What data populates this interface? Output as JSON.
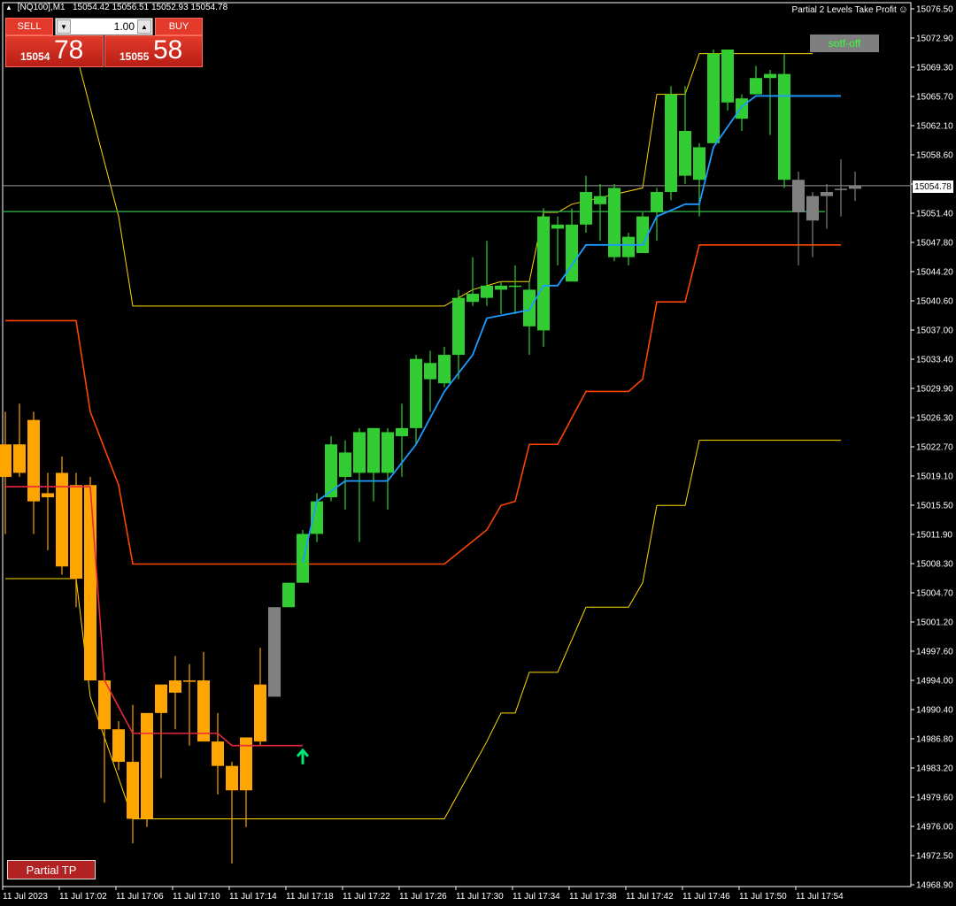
{
  "header": {
    "symbol": "[NQ100],M1",
    "ohlc": "15054.42 15056.51 15052.93 15054.78",
    "ea_name": "Partial 2 Levels Take Profit",
    "ea_icon": "smiley-icon"
  },
  "trade_panel": {
    "sell_label": "SELL",
    "buy_label": "BUY",
    "lot": "1.00",
    "bid_prefix": "15054",
    "bid_big": "78",
    "ask_prefix": "15055",
    "ask_big": "58"
  },
  "buttons": {
    "softoff_label": "sotf-off",
    "partial_tp_label": "Partial TP"
  },
  "current_price_label": "15054.78",
  "colors": {
    "bull_green": "#32cd32",
    "bear_orange": "#ffa500",
    "neutral_gray": "#808080",
    "grid_frame": "#ffffff",
    "blue_line": "#1e9bff",
    "red_line": "#ff4500",
    "yellow_line": "#ffd700",
    "green_hline": "#2ea043",
    "signal_arrow": "#00e676"
  },
  "chart_data": {
    "type": "candlestick",
    "y_ticks": [
      "15076.50",
      "15072.90",
      "15069.30",
      "15065.70",
      "15062.10",
      "15058.60",
      "15055.00",
      "15051.40",
      "15047.80",
      "15044.20",
      "15040.60",
      "15037.00",
      "15033.40",
      "15029.90",
      "15026.30",
      "15022.70",
      "15019.10",
      "15015.50",
      "15011.90",
      "15008.30",
      "15004.70",
      "15001.20",
      "14997.60",
      "14994.00",
      "14990.40",
      "14986.80",
      "14983.20",
      "14979.60",
      "14976.00",
      "14972.50",
      "14968.90"
    ],
    "x_ticks": [
      "11 Jul 2023",
      "11 Jul 17:02",
      "11 Jul 17:06",
      "11 Jul 17:10",
      "11 Jul 17:14",
      "11 Jul 17:18",
      "11 Jul 17:22",
      "11 Jul 17:26",
      "11 Jul 17:30",
      "11 Jul 17:34",
      "11 Jul 17:38",
      "11 Jul 17:42",
      "11 Jul 17:46",
      "11 Jul 17:50",
      "11 Jul 17:54"
    ],
    "ylim": [
      14968.9,
      15076.5
    ],
    "current_price": 15054.78,
    "green_level": 15051.6,
    "candles": [
      {
        "o": 15019.0,
        "h": 15027.0,
        "l": 15012.0,
        "c": 15023.0,
        "col": "orange"
      },
      {
        "o": 15023.0,
        "h": 15028.0,
        "l": 15019.0,
        "c": 15019.5,
        "col": "orange"
      },
      {
        "o": 15026.0,
        "h": 15027.0,
        "l": 15012.0,
        "c": 15016.0,
        "col": "orange"
      },
      {
        "o": 15016.5,
        "h": 15019.5,
        "l": 15010.0,
        "c": 15017.0,
        "col": "orange"
      },
      {
        "o": 15019.5,
        "h": 15021.5,
        "l": 15007.0,
        "c": 15008.0,
        "col": "orange"
      },
      {
        "o": 15018.0,
        "h": 15019.5,
        "l": 15003.0,
        "c": 15006.5,
        "col": "orange"
      },
      {
        "o": 15018.0,
        "h": 15019.0,
        "l": 14994.0,
        "c": 14994.0,
        "col": "orange"
      },
      {
        "o": 14994.0,
        "h": 14995.0,
        "l": 14979.0,
        "c": 14988.0,
        "col": "orange"
      },
      {
        "o": 14988.0,
        "h": 14989.0,
        "l": 14983.0,
        "c": 14984.0,
        "col": "orange"
      },
      {
        "o": 14984.0,
        "h": 14991.0,
        "l": 14974.0,
        "c": 14977.0,
        "col": "orange"
      },
      {
        "o": 14977.0,
        "h": 14990.0,
        "l": 14976.0,
        "c": 14990.0,
        "col": "orange"
      },
      {
        "o": 14990.0,
        "h": 14993.0,
        "l": 14982.0,
        "c": 14993.5,
        "col": "orange"
      },
      {
        "o": 14992.5,
        "h": 14997.0,
        "l": 14988.0,
        "c": 14994.0,
        "col": "orange"
      },
      {
        "o": 14994.0,
        "h": 14996.0,
        "l": 14986.0,
        "c": 14994.0,
        "col": "orange"
      },
      {
        "o": 14994.0,
        "h": 14997.5,
        "l": 14986.5,
        "c": 14986.5,
        "col": "orange"
      },
      {
        "o": 14986.5,
        "h": 14990.0,
        "l": 14980.0,
        "c": 14983.5,
        "col": "orange"
      },
      {
        "o": 14983.5,
        "h": 14984.0,
        "l": 14971.5,
        "c": 14980.5,
        "col": "orange"
      },
      {
        "o": 14980.5,
        "h": 14987.0,
        "l": 14976.0,
        "c": 14987.0,
        "col": "orange"
      },
      {
        "o": 14986.5,
        "h": 14998.0,
        "l": 14986.0,
        "c": 14993.5,
        "col": "orange"
      },
      {
        "o": 14992.0,
        "h": 15003.0,
        "l": 14992.0,
        "c": 15003.0,
        "col": "gray"
      },
      {
        "o": 15003.0,
        "h": 15006.0,
        "l": 15003.0,
        "c": 15006.0,
        "col": "green"
      },
      {
        "o": 15006.0,
        "h": 15012.5,
        "l": 15006.0,
        "c": 15012.0,
        "col": "green"
      },
      {
        "o": 15012.0,
        "h": 15017.0,
        "l": 15011.0,
        "c": 15016.0,
        "col": "green"
      },
      {
        "o": 15016.5,
        "h": 15024.0,
        "l": 15016.0,
        "c": 15023.0,
        "col": "green"
      },
      {
        "o": 15019.0,
        "h": 15023.5,
        "l": 15015.0,
        "c": 15022.0,
        "col": "green"
      },
      {
        "o": 15019.5,
        "h": 15025.0,
        "l": 15011.0,
        "c": 15024.5,
        "col": "green"
      },
      {
        "o": 15019.5,
        "h": 15025.0,
        "l": 15016.0,
        "c": 15025.0,
        "col": "green"
      },
      {
        "o": 15019.5,
        "h": 15025.0,
        "l": 15015.0,
        "c": 15024.5,
        "col": "green"
      },
      {
        "o": 15024.0,
        "h": 15028.0,
        "l": 15019.0,
        "c": 15025.0,
        "col": "green"
      },
      {
        "o": 15025.0,
        "h": 15034.0,
        "l": 15023.0,
        "c": 15033.5,
        "col": "green"
      },
      {
        "o": 15031.0,
        "h": 15034.5,
        "l": 15027.0,
        "c": 15033.0,
        "col": "green"
      },
      {
        "o": 15030.5,
        "h": 15035.0,
        "l": 15030.0,
        "c": 15034.0,
        "col": "green"
      },
      {
        "o": 15034.0,
        "h": 15042.0,
        "l": 15031.0,
        "c": 15041.0,
        "col": "green"
      },
      {
        "o": 15040.5,
        "h": 15046.0,
        "l": 15040.0,
        "c": 15041.5,
        "col": "green"
      },
      {
        "o": 15041.0,
        "h": 15048.0,
        "l": 15040.0,
        "c": 15042.5,
        "col": "green"
      },
      {
        "o": 15042.0,
        "h": 15043.0,
        "l": 15039.0,
        "c": 15042.5,
        "col": "green"
      },
      {
        "o": 15042.5,
        "h": 15045.0,
        "l": 15039.0,
        "c": 15042.5,
        "col": "green"
      },
      {
        "o": 15042.0,
        "h": 15043.0,
        "l": 15034.0,
        "c": 15037.5,
        "col": "green"
      },
      {
        "o": 15037.0,
        "h": 15052.0,
        "l": 15035.0,
        "c": 15051.0,
        "col": "green"
      },
      {
        "o": 15050.0,
        "h": 15051.0,
        "l": 15045.0,
        "c": 15049.5,
        "col": "green"
      },
      {
        "o": 15043.0,
        "h": 15052.0,
        "l": 15043.0,
        "c": 15050.0,
        "col": "green"
      },
      {
        "o": 15050.0,
        "h": 15056.0,
        "l": 15049.0,
        "c": 15054.0,
        "col": "green"
      },
      {
        "o": 15053.5,
        "h": 15055.0,
        "l": 15048.0,
        "c": 15052.5,
        "col": "green"
      },
      {
        "o": 15046.0,
        "h": 15055.0,
        "l": 15045.5,
        "c": 15054.5,
        "col": "green"
      },
      {
        "o": 15046.0,
        "h": 15049.0,
        "l": 15045.0,
        "c": 15048.5,
        "col": "green"
      },
      {
        "o": 15046.5,
        "h": 15051.5,
        "l": 15046.5,
        "c": 15051.0,
        "col": "green"
      },
      {
        "o": 15051.5,
        "h": 15054.5,
        "l": 15048.0,
        "c": 15054.0,
        "col": "green"
      },
      {
        "o": 15054.0,
        "h": 15067.0,
        "l": 15053.0,
        "c": 15066.0,
        "col": "green"
      },
      {
        "o": 15061.5,
        "h": 15067.0,
        "l": 15055.0,
        "c": 15056.0,
        "col": "green"
      },
      {
        "o": 15059.5,
        "h": 15060.0,
        "l": 15051.0,
        "c": 15055.5,
        "col": "green"
      },
      {
        "o": 15060.0,
        "h": 15071.5,
        "l": 15060.0,
        "c": 15071.0,
        "col": "green"
      },
      {
        "o": 15065.0,
        "h": 15071.5,
        "l": 15064.0,
        "c": 15071.5,
        "col": "green"
      },
      {
        "o": 15063.0,
        "h": 15066.0,
        "l": 15061.5,
        "c": 15065.5,
        "col": "green"
      },
      {
        "o": 15066.0,
        "h": 15069.5,
        "l": 15066.0,
        "c": 15068.0,
        "col": "green"
      },
      {
        "o": 15068.0,
        "h": 15069.0,
        "l": 15061.0,
        "c": 15068.5,
        "col": "green"
      },
      {
        "o": 15068.5,
        "h": 15071.0,
        "l": 15054.5,
        "c": 15055.5,
        "col": "green"
      },
      {
        "o": 15055.5,
        "h": 15056.5,
        "l": 15045.0,
        "c": 15051.5,
        "col": "gray"
      },
      {
        "o": 15053.5,
        "h": 15054.0,
        "l": 15046.0,
        "c": 15050.5,
        "col": "gray"
      },
      {
        "o": 15054.0,
        "h": 15055.0,
        "l": 15049.5,
        "c": 15053.5,
        "col": "gray"
      },
      {
        "o": 15054.3,
        "h": 15058.0,
        "l": 15051.0,
        "c": 15054.4,
        "col": "gray"
      },
      {
        "o": 15054.4,
        "h": 15056.5,
        "l": 15052.9,
        "c": 15054.8,
        "col": "gray"
      }
    ],
    "indicators": {
      "blue_trailing": [
        {
          "i": 21,
          "v": 15008.5
        },
        {
          "i": 22,
          "v": 15016.0
        },
        {
          "i": 24,
          "v": 15018.5
        },
        {
          "i": 27,
          "v": 15018.5
        },
        {
          "i": 29,
          "v": 15023.0
        },
        {
          "i": 31,
          "v": 15029.5
        },
        {
          "i": 33,
          "v": 15034.0
        },
        {
          "i": 34,
          "v": 15038.5
        },
        {
          "i": 37,
          "v": 15039.5
        },
        {
          "i": 38,
          "v": 15042.5
        },
        {
          "i": 39,
          "v": 15042.5
        },
        {
          "i": 40,
          "v": 15045.0
        },
        {
          "i": 41,
          "v": 15047.5
        },
        {
          "i": 45,
          "v": 15047.5
        },
        {
          "i": 46,
          "v": 15051.0
        },
        {
          "i": 48,
          "v": 15052.5
        },
        {
          "i": 49,
          "v": 15052.5
        },
        {
          "i": 50,
          "v": 15059.5
        },
        {
          "i": 52,
          "v": 15064.5
        },
        {
          "i": 53,
          "v": 15065.8
        },
        {
          "i": 59,
          "v": 15065.8
        }
      ],
      "red_level": [
        {
          "i": 0,
          "v": 15038.2
        },
        {
          "i": 5,
          "v": 15038.2
        },
        {
          "i": 6,
          "v": 15027.0
        },
        {
          "i": 8,
          "v": 15018.0
        },
        {
          "i": 9,
          "v": 15008.3
        },
        {
          "i": 31,
          "v": 15008.3
        },
        {
          "i": 34,
          "v": 15012.5
        },
        {
          "i": 35,
          "v": 15015.5
        },
        {
          "i": 36,
          "v": 15016.0
        },
        {
          "i": 37,
          "v": 15023.0
        },
        {
          "i": 39,
          "v": 15023.0
        },
        {
          "i": 41,
          "v": 15029.5
        },
        {
          "i": 44,
          "v": 15029.5
        },
        {
          "i": 45,
          "v": 15031.0
        },
        {
          "i": 46,
          "v": 15040.5
        },
        {
          "i": 48,
          "v": 15040.5
        },
        {
          "i": 49,
          "v": 15047.5
        },
        {
          "i": 59,
          "v": 15047.5
        }
      ],
      "yellow_upper": [
        {
          "i": 5,
          "v": 15071.0
        },
        {
          "i": 8,
          "v": 15051.0
        },
        {
          "i": 9,
          "v": 15040.0
        },
        {
          "i": 31,
          "v": 15040.0
        },
        {
          "i": 33,
          "v": 15042.0
        },
        {
          "i": 35,
          "v": 15043.0
        },
        {
          "i": 37,
          "v": 15043.0
        },
        {
          "i": 38,
          "v": 15051.5
        },
        {
          "i": 39,
          "v": 15051.5
        },
        {
          "i": 40,
          "v": 15052.5
        },
        {
          "i": 45,
          "v": 15054.5
        },
        {
          "i": 46,
          "v": 15066.0
        },
        {
          "i": 48,
          "v": 15066.0
        },
        {
          "i": 49,
          "v": 15071.0
        },
        {
          "i": 57,
          "v": 15071.0
        }
      ],
      "yellow_lower": [
        {
          "i": 0,
          "v": 15006.5
        },
        {
          "i": 5,
          "v": 15006.5
        },
        {
          "i": 6,
          "v": 14992.0
        },
        {
          "i": 9,
          "v": 14977.0
        },
        {
          "i": 31,
          "v": 14977.0
        },
        {
          "i": 34,
          "v": 14986.5
        },
        {
          "i": 35,
          "v": 14990.0
        },
        {
          "i": 36,
          "v": 14990.0
        },
        {
          "i": 37,
          "v": 14995.0
        },
        {
          "i": 39,
          "v": 14995.0
        },
        {
          "i": 41,
          "v": 15003.0
        },
        {
          "i": 44,
          "v": 15003.0
        },
        {
          "i": 45,
          "v": 15006.0
        },
        {
          "i": 46,
          "v": 15015.5
        },
        {
          "i": 48,
          "v": 15015.5
        },
        {
          "i": 49,
          "v": 15023.5
        },
        {
          "i": 59,
          "v": 15023.5
        }
      ],
      "crimson_stop": [
        {
          "i": 0,
          "v": 15017.8
        },
        {
          "i": 6,
          "v": 15017.8
        },
        {
          "i": 7,
          "v": 14994.0
        },
        {
          "i": 9,
          "v": 14987.5
        },
        {
          "i": 15,
          "v": 14987.5
        },
        {
          "i": 16,
          "v": 14986.0
        },
        {
          "i": 21,
          "v": 14986.0
        }
      ],
      "buy_arrow": {
        "i": 21,
        "v": 14985.0
      }
    }
  }
}
